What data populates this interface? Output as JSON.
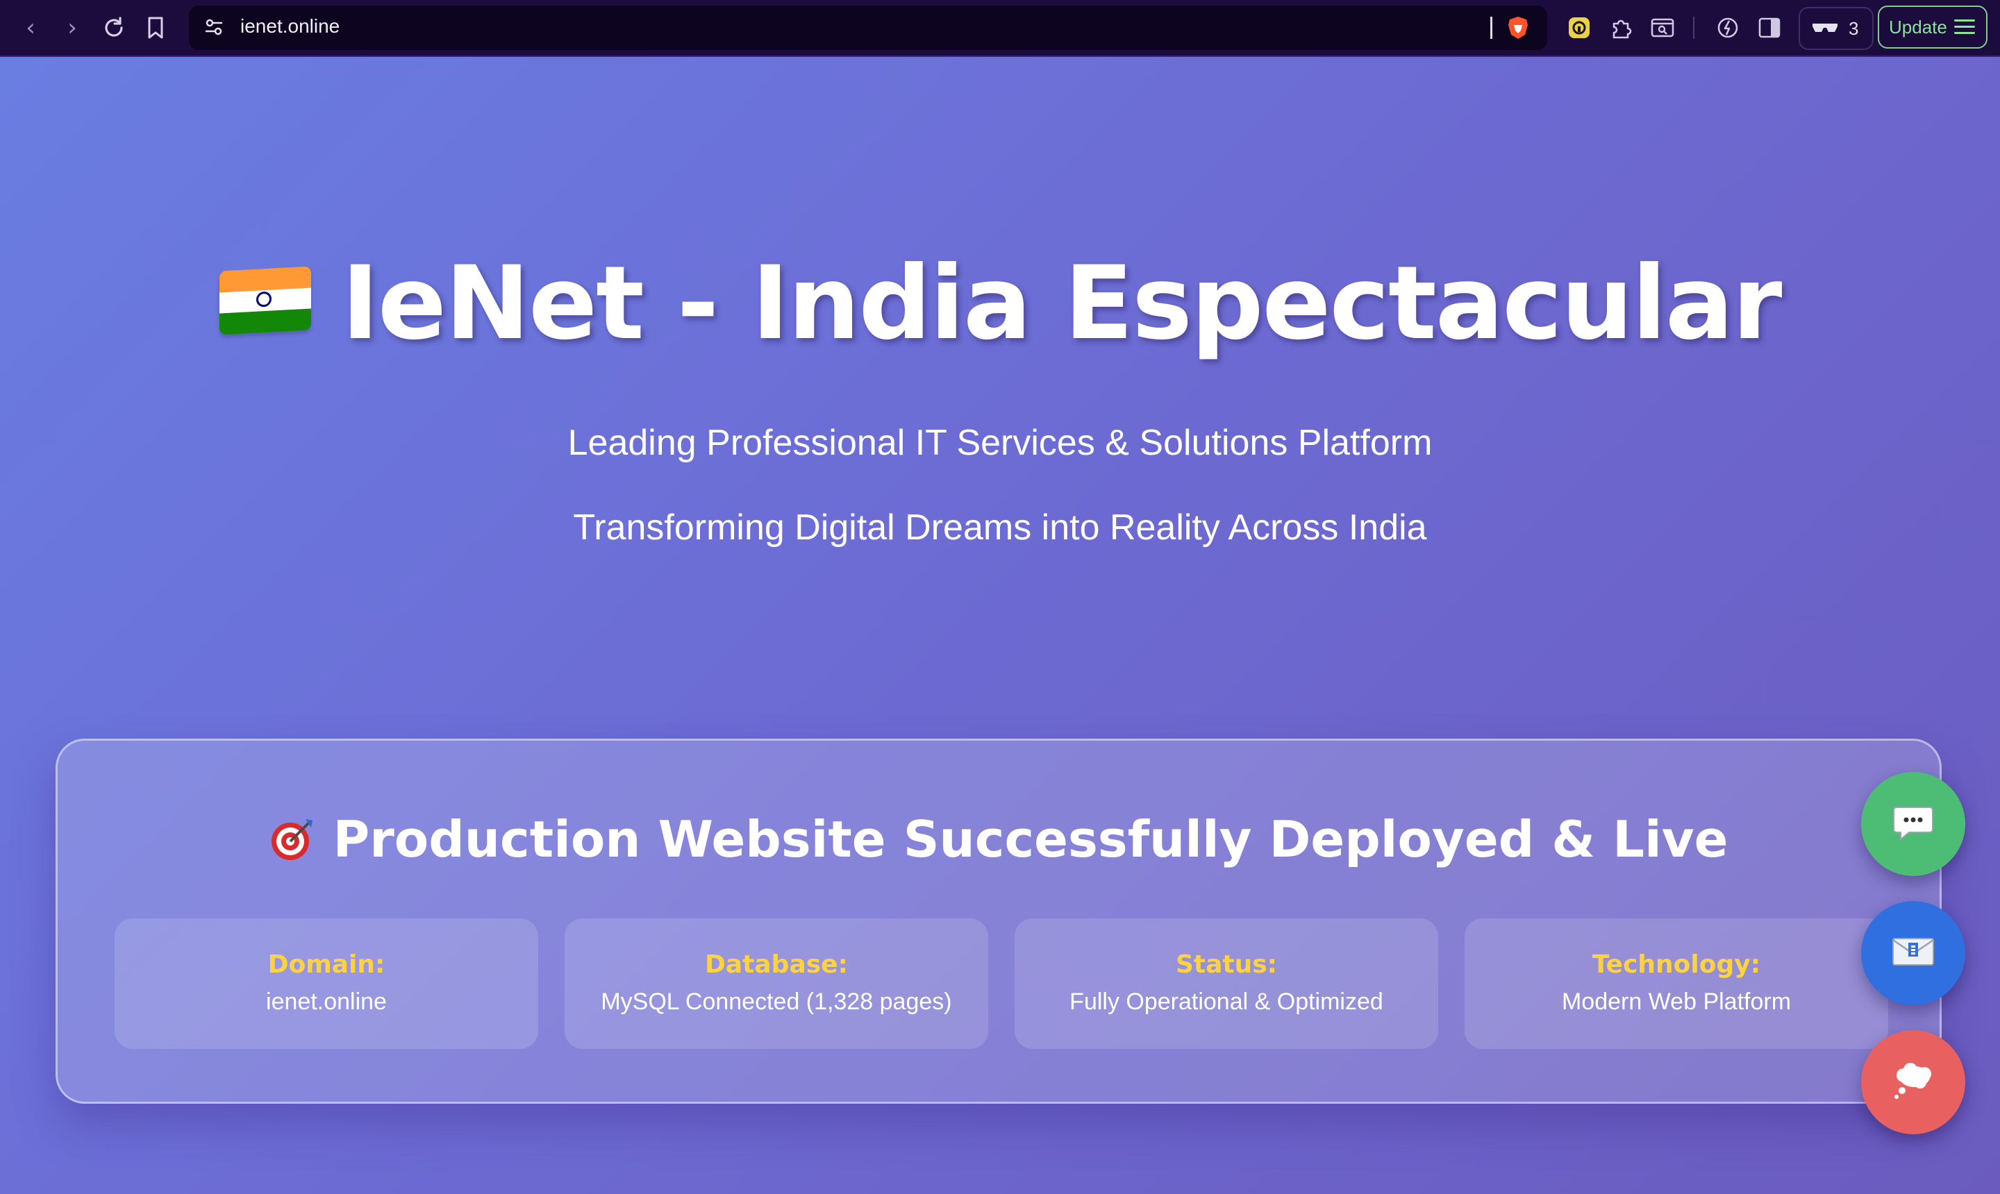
{
  "browser": {
    "url": "ienet.online",
    "tracker_count": "3",
    "update_label": "Update"
  },
  "hero": {
    "title": "IeNet - India Espectacular",
    "subtitle_1": "Leading Professional IT Services & Solutions Platform",
    "subtitle_2": "Transforming Digital Dreams into Reality Across India"
  },
  "status_panel": {
    "title": "Production Website Successfully Deployed & Live",
    "cards": [
      {
        "label": "Domain:",
        "value": "ienet.online"
      },
      {
        "label": "Database:",
        "value": "MySQL Connected (1,328 pages)"
      },
      {
        "label": "Status:",
        "value": "Fully Operational & Optimized"
      },
      {
        "label": "Technology:",
        "value": "Modern Web Platform"
      }
    ]
  },
  "colors": {
    "background_start": "#6a7ee2",
    "background_end": "#6b5bbf",
    "card_label": "#ffd23f",
    "fab_chat": "#4dbd75",
    "fab_mail": "#2f6fe0",
    "fab_thought": "#e96060",
    "update_accent": "#8ee29a"
  },
  "icons": {
    "hero_flag": "india-flag-icon",
    "panel_title": "target-icon",
    "fab_1": "chat-bubble-icon",
    "fab_2": "envelope-icon",
    "fab_3": "thought-bubble-icon"
  }
}
